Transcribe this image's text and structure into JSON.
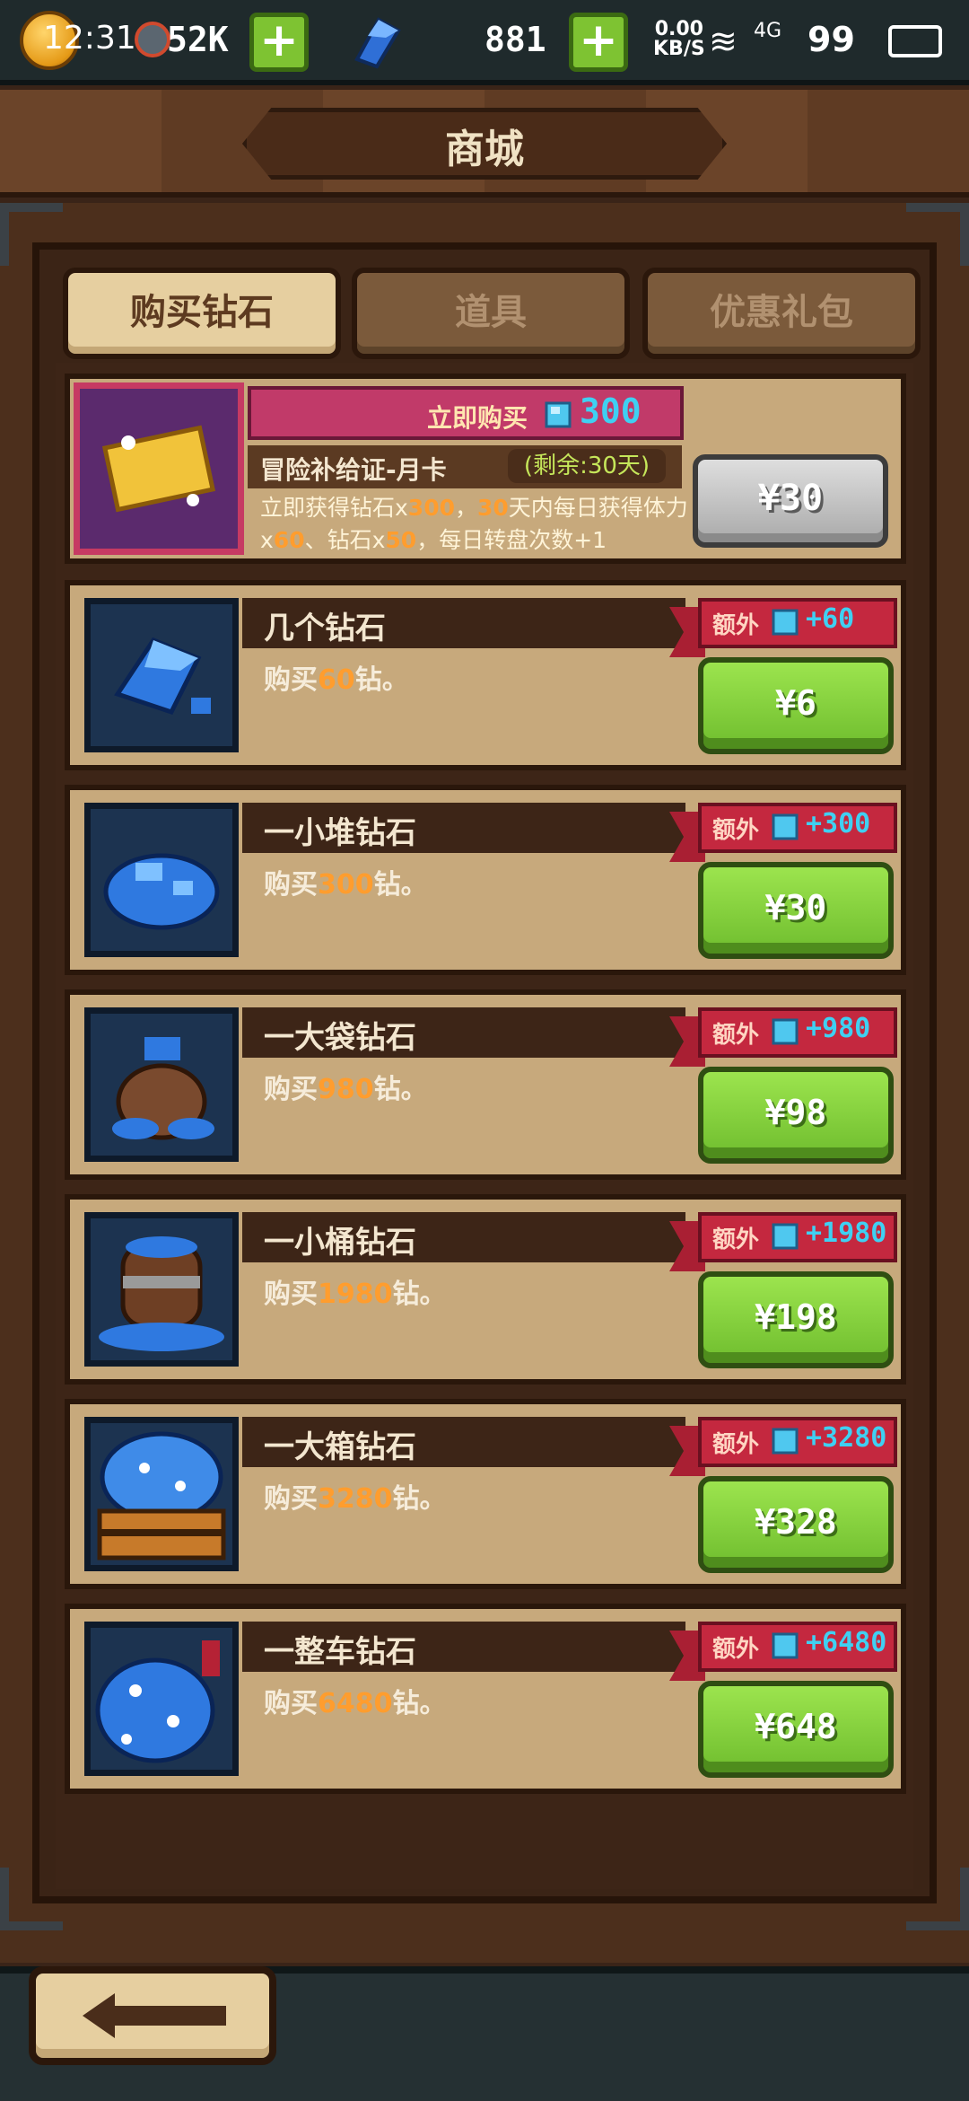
{
  "status": {
    "time": "12:31",
    "energy": "52K",
    "gems": "881",
    "network_speed": "0.00",
    "network_unit": "KB/S",
    "network_type": "4G",
    "battery": "99"
  },
  "header": {
    "title": "商城"
  },
  "tabs": [
    {
      "label": "购买钻石",
      "active": true
    },
    {
      "label": "道具",
      "active": false
    },
    {
      "label": "优惠礼包",
      "active": false
    }
  ],
  "month_card": {
    "ribbon_label": "立即购买",
    "ribbon_value": "300",
    "title": "冒险补给证-月卡",
    "remaining": "(剩余:30天)",
    "desc_1": "立即获得钻石x",
    "desc_1_val": "300",
    "desc_2": "，",
    "desc_3_val": "30",
    "desc_3": "天内每日获得体力",
    "desc_4": "x",
    "desc_4_val": "60",
    "desc_5": "、钻石x",
    "desc_5_val": "50",
    "desc_6": "，每日转盘次数+1",
    "price": "¥30"
  },
  "products": [
    {
      "name": "几个钻石",
      "desc_prefix": "购买",
      "amount": "60",
      "desc_suffix": "钻。",
      "bonus_label": "额外",
      "bonus": "+60",
      "price": "¥6"
    },
    {
      "name": "一小堆钻石",
      "desc_prefix": "购买",
      "amount": "300",
      "desc_suffix": "钻。",
      "bonus_label": "额外",
      "bonus": "+300",
      "price": "¥30"
    },
    {
      "name": "一大袋钻石",
      "desc_prefix": "购买",
      "amount": "980",
      "desc_suffix": "钻。",
      "bonus_label": "额外",
      "bonus": "+980",
      "price": "¥98"
    },
    {
      "name": "一小桶钻石",
      "desc_prefix": "购买",
      "amount": "1980",
      "desc_suffix": "钻。",
      "bonus_label": "额外",
      "bonus": "+1980",
      "price": "¥198"
    },
    {
      "name": "一大箱钻石",
      "desc_prefix": "购买",
      "amount": "3280",
      "desc_suffix": "钻。",
      "bonus_label": "额外",
      "bonus": "+3280",
      "price": "¥328"
    },
    {
      "name": "一整车钻石",
      "desc_prefix": "购买",
      "amount": "6480",
      "desc_suffix": "钻。",
      "bonus_label": "额外",
      "bonus": "+6480",
      "price": "¥648"
    }
  ],
  "icons": {
    "coin": "coin-icon",
    "energy": "energy-icon",
    "gem": "gem-icon",
    "back": "back-arrow-icon"
  },
  "colors": {
    "accent_green": "#7ec332",
    "bonus_red": "#c4283f",
    "gem_cyan": "#3fd0f2",
    "highlight_orange": "#ff9d2e"
  }
}
